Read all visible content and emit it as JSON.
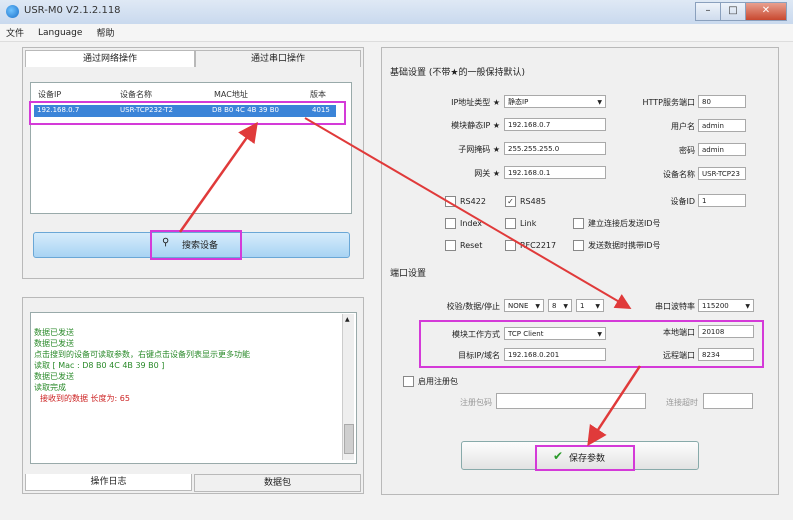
{
  "window": {
    "title": "USR-M0 V2.1.2.118",
    "close_label": "✕"
  },
  "menu": [
    "文件",
    "Language",
    "帮助"
  ],
  "left": {
    "tabs": [
      "通过网络操作",
      "通过串口操作"
    ],
    "table_headers": [
      "设备IP",
      "设备名称",
      "MAC地址",
      "版本"
    ],
    "row": [
      "192.168.0.7",
      "USR-TCP232-T2",
      "D8 B0 4C 4B 39 B0",
      "4015"
    ],
    "search_label": "搜索设备",
    "log_lines": [
      {
        "text": "数据已发送",
        "cls": "g"
      },
      {
        "text": "数据已发送",
        "cls": "g"
      },
      {
        "text": "点击搜到的设备可读取参数，右键点击设备列表显示更多功能",
        "cls": "g"
      },
      {
        "text": "读取 [ Mac : D8 B0 4C 4B 39 B0 ]",
        "cls": "g"
      },
      {
        "text": "数据已发送",
        "cls": "g"
      },
      {
        "text": "读取完成",
        "cls": "g"
      },
      {
        "text": "接收到的数据 长度为: 65",
        "cls": "r"
      }
    ],
    "bottom_tabs": [
      "操作日志",
      "数据包"
    ]
  },
  "right": {
    "basic_title": "基础设置 (不带★的一般保持默认)",
    "ip_type_label": "IP地址类型 ★",
    "ip_type": "静态IP",
    "module_ip_label": "模块静态IP ★",
    "module_ip": "192.168.0.7",
    "subnet_label": "子网掩码 ★",
    "subnet": "255.255.255.0",
    "gateway_label": "网关 ★",
    "gateway": "192.168.0.1",
    "http_port_label": "HTTP服务端口",
    "http_port": "80",
    "username_label": "用户名",
    "username": "admin",
    "password_label": "密码",
    "password": "admin",
    "device_name_label": "设备名称",
    "device_name": "USR-TCP23",
    "device_id_label": "设备ID",
    "device_id": "1",
    "checks": [
      {
        "label": "RS422",
        "checked": false
      },
      {
        "label": "RS485",
        "checked": true
      },
      {
        "label": "Index",
        "checked": false
      },
      {
        "label": "Link",
        "checked": false
      },
      {
        "label": "建立连接后发送ID号",
        "checked": false
      },
      {
        "label": "Reset",
        "checked": false
      },
      {
        "label": "RFC2217",
        "checked": false
      },
      {
        "label": "发送数据时携带ID号",
        "checked": false
      }
    ],
    "serial_title": "端口设置",
    "parity_label": "校验/数据/停止",
    "parity": "NONE",
    "databits": "8",
    "stopbits": "1",
    "baud_label": "串口波特率",
    "baud": "115200",
    "mode_label": "模块工作方式",
    "mode": "TCP Client",
    "local_port_label": "本地端口",
    "local_port": "20108",
    "target_label": "目标IP/域名",
    "target": "192.168.0.201",
    "remote_port_label": "远程端口",
    "remote_port": "8234",
    "register_label": "启用注册包",
    "register_code_label": "注册包码",
    "timeout_label": "连接超时",
    "save_label": "保存参数"
  }
}
